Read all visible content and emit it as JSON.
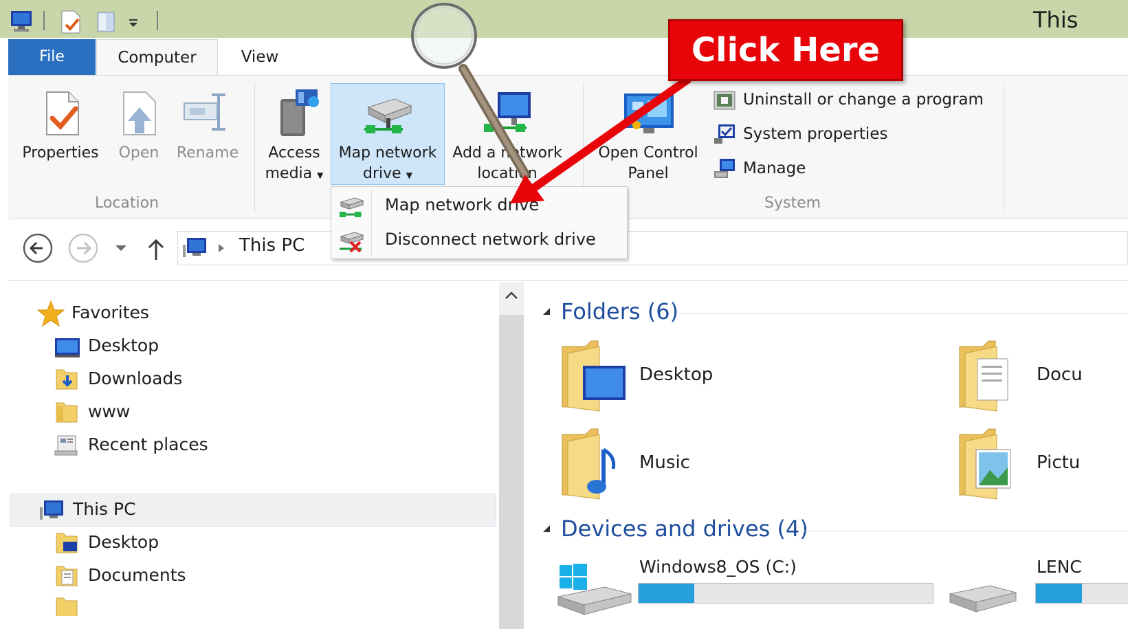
{
  "window": {
    "title_fragment": "This"
  },
  "tabs": {
    "file": "File",
    "computer": "Computer",
    "view": "View"
  },
  "ribbon": {
    "location": {
      "group_label": "Location",
      "properties": "Properties",
      "open": "Open",
      "rename": "Rename"
    },
    "network": {
      "access_media_line1": "Access",
      "access_media_line2": "media",
      "map_drive_line1": "Map network",
      "map_drive_line2": "drive",
      "add_location_line1": "Add a network",
      "add_location_line2": "location",
      "open_cp_line1": "Open Control",
      "open_cp_line2": "Panel"
    },
    "system": {
      "group_label": "System",
      "uninstall": "Uninstall or change a program",
      "system_properties": "System properties",
      "manage": "Manage"
    }
  },
  "dropdown": {
    "items": [
      {
        "label": "Map network drive"
      },
      {
        "label": "Disconnect network drive"
      }
    ]
  },
  "address": {
    "path": "This PC"
  },
  "nav_pane": {
    "favorites_label": "Favorites",
    "favorites": [
      "Desktop",
      "Downloads",
      "www",
      "Recent places"
    ],
    "this_pc_label": "This PC",
    "this_pc_children": [
      "Desktop",
      "Documents"
    ]
  },
  "content": {
    "folders_header": "Folders (6)",
    "folders": [
      "Desktop",
      "Docu",
      "Music",
      "Pictu"
    ],
    "devices_header": "Devices and drives (4)",
    "drives": [
      {
        "name": "Windows8_OS (C:)",
        "used_fraction": 0.19
      },
      {
        "name": "LENC",
        "used_fraction": 0.5
      }
    ]
  },
  "callout": {
    "label": "Click Here"
  },
  "colors": {
    "file_tab": "#2b6fc0",
    "title_bar": "#c9d6a9",
    "selection": "#cfe6fa",
    "callout": "#e8050a",
    "section_header": "#1e4d9e",
    "drive_bar": "#26a0da"
  }
}
